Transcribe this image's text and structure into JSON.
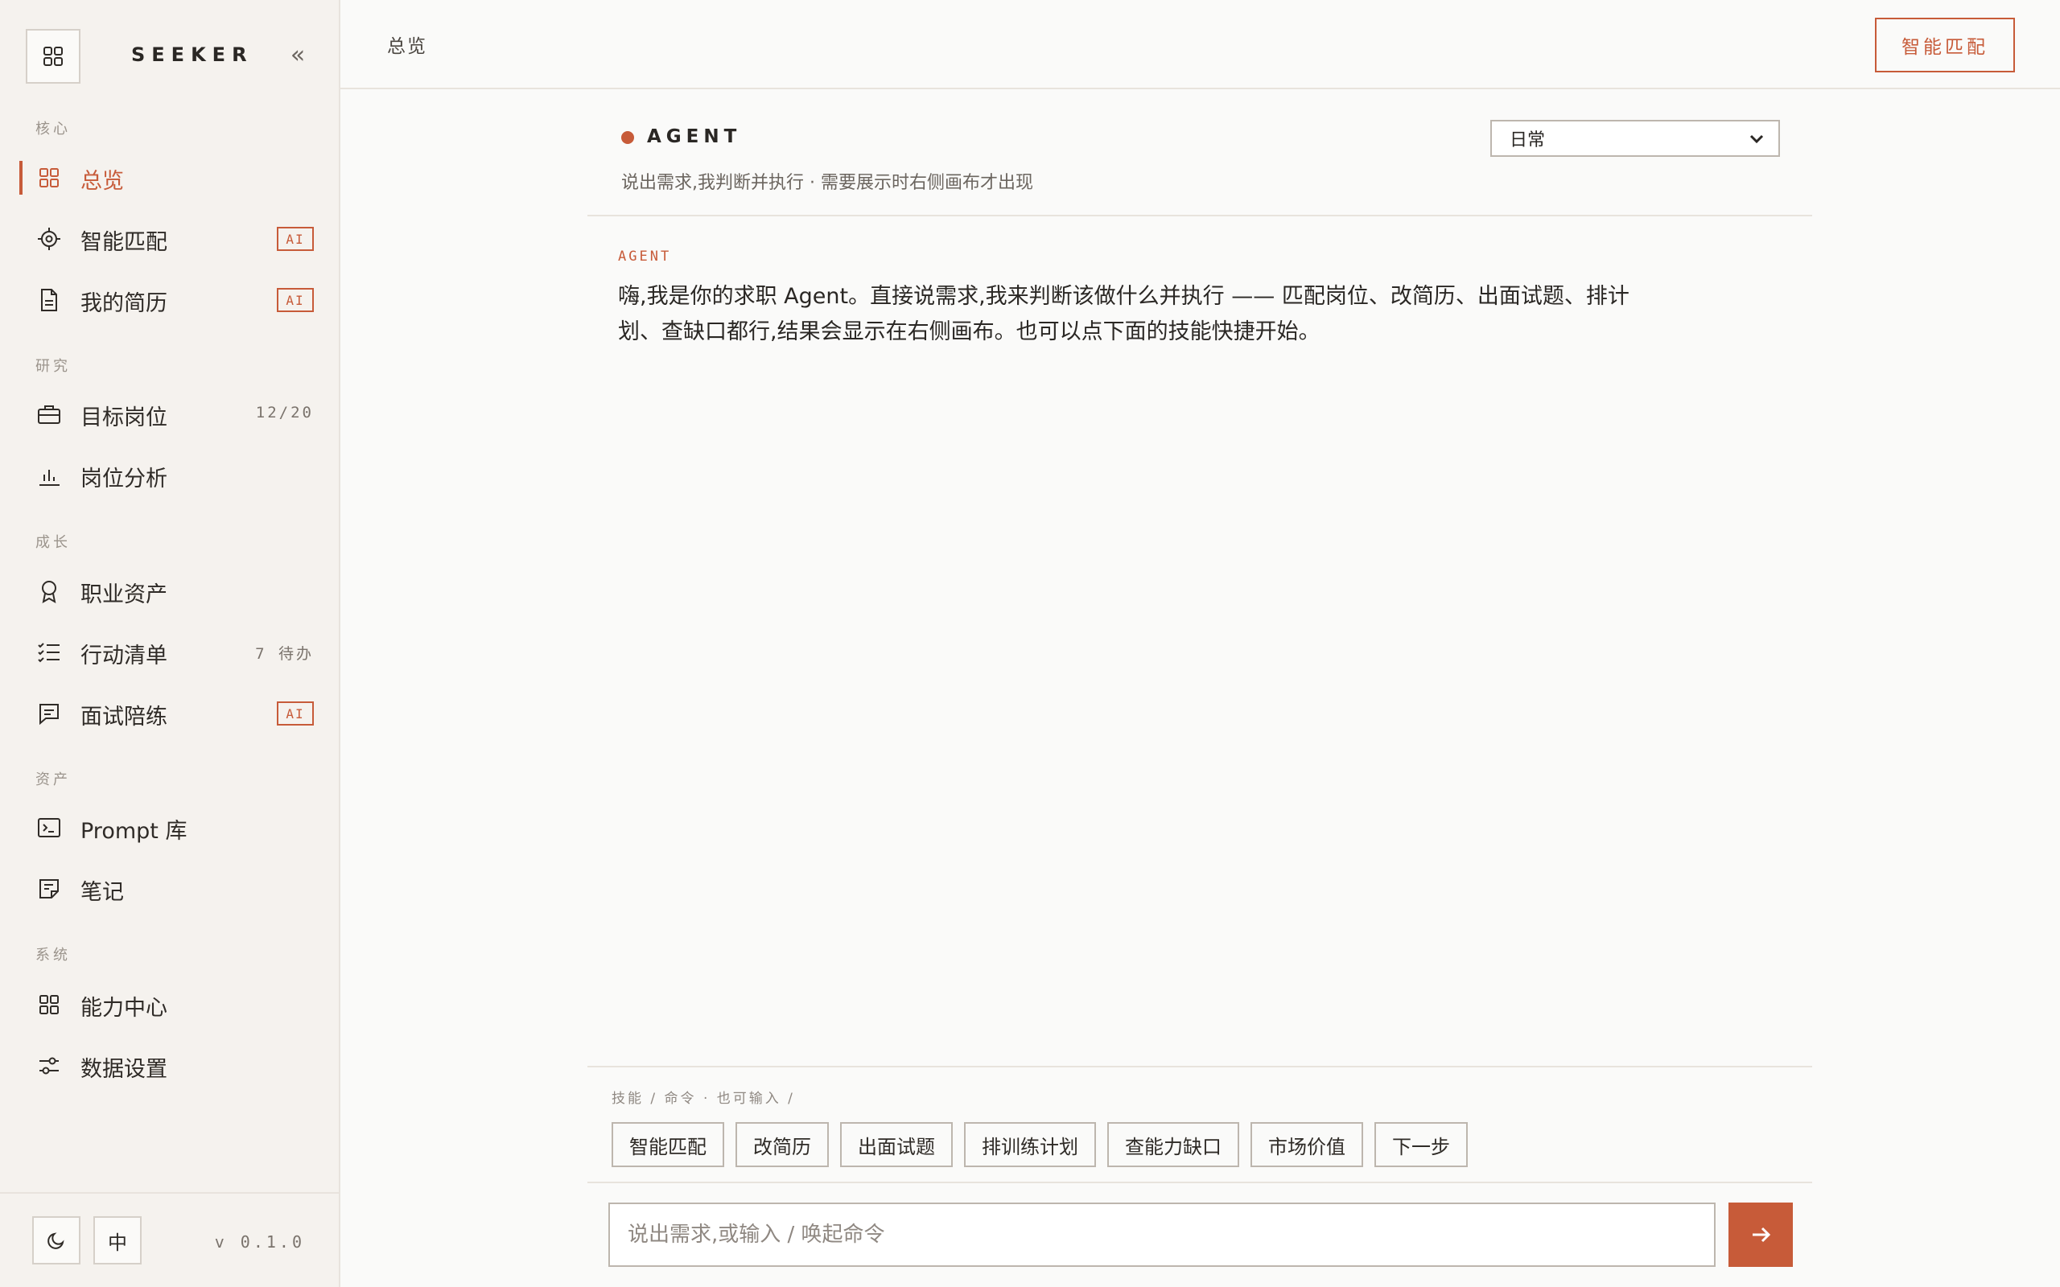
{
  "app": {
    "brand": "SEEKER",
    "version": "v 0.1.0",
    "lang_toggle": "中"
  },
  "colors": {
    "accent": "#c75b39",
    "sidebar_bg": "#f5f2ee",
    "page_bg": "#fafaf9"
  },
  "sidebar": {
    "sections": [
      {
        "title": "核心",
        "items": [
          {
            "label": "总览",
            "icon": "grid-icon",
            "active": true
          },
          {
            "label": "智能匹配",
            "icon": "target-icon",
            "badge": "AI"
          },
          {
            "label": "我的简历",
            "icon": "document-icon",
            "badge": "AI"
          }
        ]
      },
      {
        "title": "研究",
        "items": [
          {
            "label": "目标岗位",
            "icon": "briefcase-icon",
            "count": "12/20"
          },
          {
            "label": "岗位分析",
            "icon": "bar-chart-icon"
          }
        ]
      },
      {
        "title": "成长",
        "items": [
          {
            "label": "职业资产",
            "icon": "award-icon"
          },
          {
            "label": "行动清单",
            "icon": "checklist-icon",
            "count": "7 待办"
          },
          {
            "label": "面试陪练",
            "icon": "chat-icon",
            "badge": "AI"
          }
        ]
      },
      {
        "title": "资产",
        "items": [
          {
            "label": "Prompt 库",
            "icon": "terminal-icon"
          },
          {
            "label": "笔记",
            "icon": "note-icon"
          }
        ]
      },
      {
        "title": "系统",
        "items": [
          {
            "label": "能力中心",
            "icon": "grid-icon"
          },
          {
            "label": "数据设置",
            "icon": "sliders-icon"
          }
        ]
      }
    ]
  },
  "topbar": {
    "breadcrumb": "总览",
    "action_button": "智能匹配"
  },
  "agent": {
    "title": "AGENT",
    "subtitle": "说出需求,我判断并执行 · 需要展示时右侧画布才出现",
    "mode_selected": "日常",
    "message_label": "AGENT",
    "message_text": "嗨,我是你的求职 Agent。直接说需求,我来判断该做什么并执行 —— 匹配岗位、改简历、出面试题、排计划、查缺口都行,结果会显示在右侧画布。也可以点下面的技能快捷开始。"
  },
  "skills": {
    "label": "技能 / 命令 · 也可输入 /",
    "chips": [
      "智能匹配",
      "改简历",
      "出面试题",
      "排训练计划",
      "查能力缺口",
      "市场价值",
      "下一步"
    ]
  },
  "input": {
    "placeholder": "说出需求,或输入 / 唤起命令",
    "value": ""
  }
}
